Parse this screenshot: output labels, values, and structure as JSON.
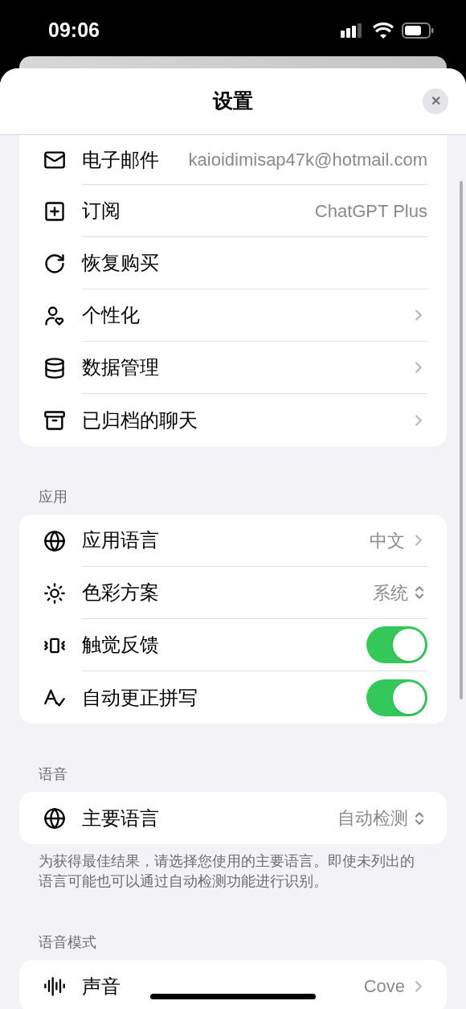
{
  "status_bar": {
    "time": "09:06"
  },
  "sheet": {
    "title": "设置",
    "close": "✕"
  },
  "sections": [
    {
      "rows": [
        {
          "kind": "value",
          "label": "电子邮件",
          "value": "kaioidimisap47k@hotmail.com"
        },
        {
          "kind": "value",
          "label": "订阅",
          "value": "ChatGPT Plus"
        },
        {
          "kind": "action",
          "label": "恢复购买"
        },
        {
          "kind": "link",
          "label": "个性化"
        },
        {
          "kind": "link",
          "label": "数据管理"
        },
        {
          "kind": "link",
          "label": "已归档的聊天"
        }
      ]
    },
    {
      "header": "应用",
      "rows": [
        {
          "kind": "link",
          "label": "应用语言",
          "value": "中文"
        },
        {
          "kind": "picker",
          "label": "色彩方案",
          "value": "系统"
        },
        {
          "kind": "toggle",
          "label": "触觉反馈",
          "on": true
        },
        {
          "kind": "toggle",
          "label": "自动更正拼写",
          "on": true
        }
      ]
    },
    {
      "header": "语音",
      "rows": [
        {
          "kind": "picker",
          "label": "主要语言",
          "value": "自动检测"
        }
      ],
      "footnote": "为获得最佳结果，请选择您使用的主要语言。即使未列出的语言可能也可以通过自动检测功能进行识别。"
    },
    {
      "header": "语音模式",
      "rows": [
        {
          "kind": "link",
          "label": "声音",
          "value": "Cove"
        }
      ]
    }
  ]
}
